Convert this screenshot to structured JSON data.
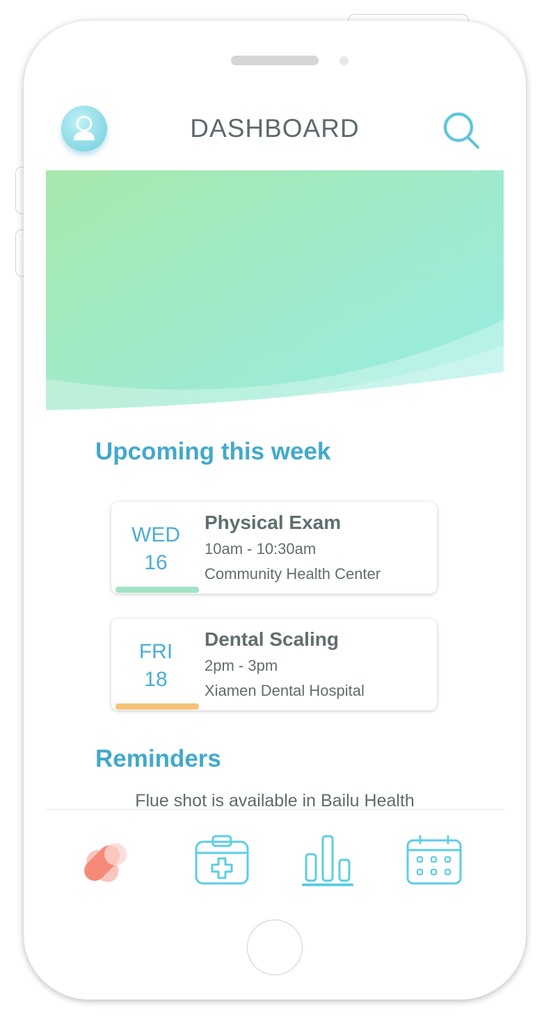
{
  "header": {
    "title": "DASHBOARD",
    "profile_icon": "user-avatar-icon",
    "search_icon": "search-icon"
  },
  "banner": {
    "gradient_start": "#a8e8ad",
    "gradient_end": "#98ece4"
  },
  "upcoming": {
    "title": "Upcoming this week",
    "appointments": [
      {
        "weekday": "WED",
        "day": "16",
        "title": "Physical Exam",
        "time": "10am - 10:30am",
        "location": "Community Health Center",
        "accent_color": "#a3e3c6"
      },
      {
        "weekday": "FRI",
        "day": "18",
        "title": "Dental Scaling",
        "time": "2pm - 3pm",
        "location": "Xiamen Dental Hospital",
        "accent_color": "#f6c27a"
      }
    ]
  },
  "reminders": {
    "title": "Reminders",
    "items": [
      "Flue shot is available in Bailu Health"
    ]
  },
  "tab_bar": {
    "items": [
      {
        "icon": "heart-icon",
        "active": true
      },
      {
        "icon": "medical-kit-icon",
        "active": false
      },
      {
        "icon": "bar-chart-icon",
        "active": false
      },
      {
        "icon": "calendar-icon",
        "active": false
      }
    ]
  },
  "colors": {
    "accent": "#42a9cc",
    "icon": "#5ccde6",
    "heart": "#f58a78",
    "text": "#5f6e6e"
  }
}
